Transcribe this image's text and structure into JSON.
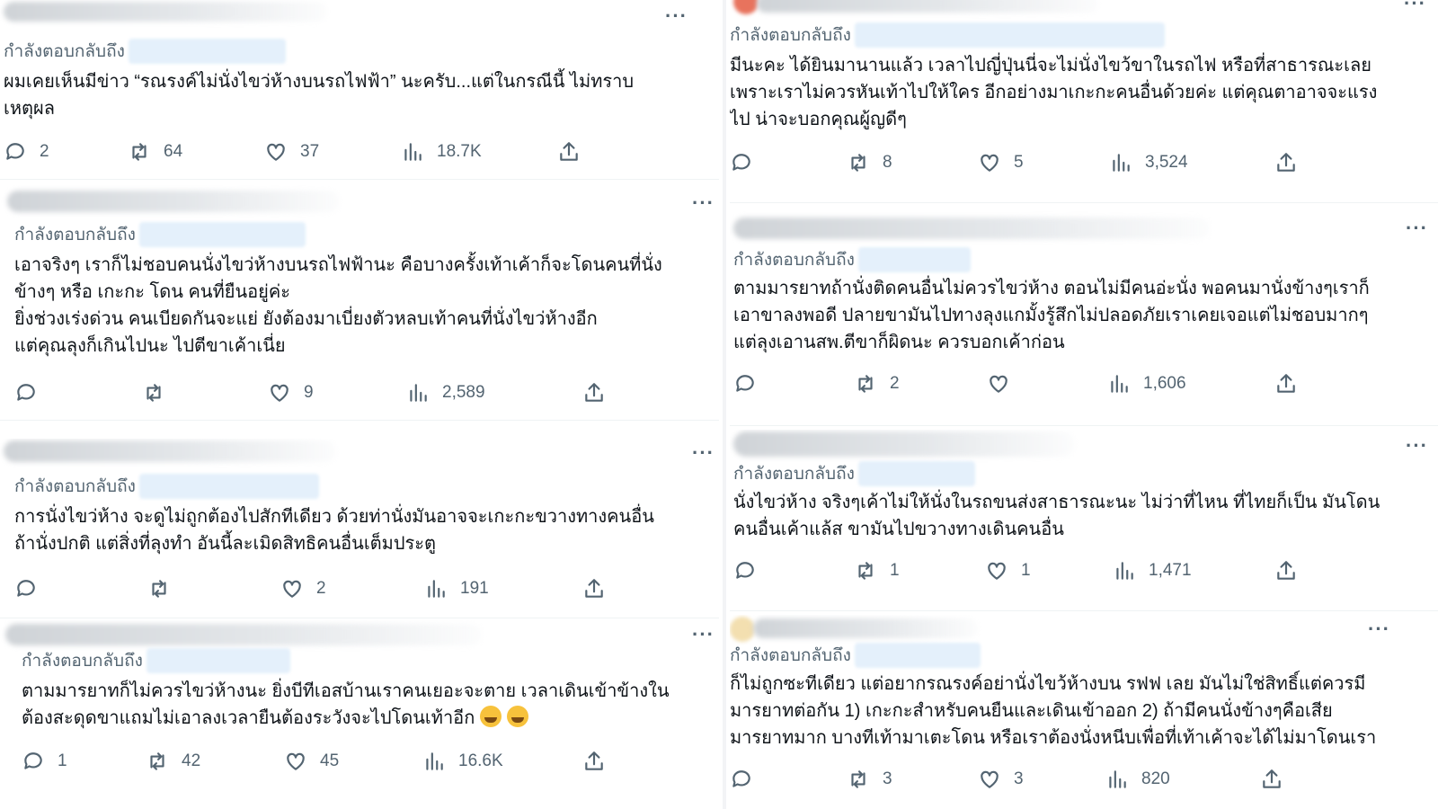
{
  "reply_prefix": "กำลังตอบกลับถึง",
  "more_label": "···",
  "tweets": [
    {
      "text": "ผมเคยเห็นมีข่าว “รณรงค์ไม่นั่งไขว่ห้างบนรถไฟฟ้า” นะครับ...แต่ในกรณีนี้ ไม่ทราบ\nเหตุผล",
      "replies": "2",
      "retweets": "64",
      "likes": "37",
      "views": "18.7K"
    },
    {
      "text": "เอาจริงๆ เราก็ไม่ชอบคนนั่งไขว่ห้างบนรถไฟฟ้านะ คือบางครั้งเท้าเค้าก็จะโดนคนที่นั่ง\nข้างๆ หรือ เกะกะ โดน คนที่ยืนอยู่ค่ะ\nยิ่งช่วงเร่งด่วน คนเบียดกันจะแย่ ยังต้องมาเบี่ยงตัวหลบเท้าคนที่นั่งไขว่ห้างอีก\nแต่คุณลุงก็เกินไปนะ ไปตีขาเค้าเนี่ย",
      "replies": "",
      "retweets": "",
      "likes": "9",
      "views": "2,589"
    },
    {
      "text": "การนั่งไขว่ห้าง จะดูไม่ถูกต้องไปสักทีเดียว ด้วยท่านั่งมันอาจจะเกะกะขวางทางคนอื่น\nถ้านั่งปกติ แต่สิ่งที่ลุงทำ อันนี้ละเมิดสิทธิคนอื่นเต็มประตู",
      "replies": "",
      "retweets": "",
      "likes": "2",
      "views": "191"
    },
    {
      "text": "ตามมารยาทก็ไม่ควรไขว่ห้างนะ ยิ่งบีทีเอสบ้านเราคนเยอะจะตาย เวลาเดินเข้าข้างใน\nต้องสะดุดขาแถมไม่เอาลงเวลายืนต้องระวังจะไปโดนเท้าอีก",
      "replies": "1",
      "retweets": "42",
      "likes": "45",
      "views": "16.6K"
    },
    {
      "text": "มีนะคะ ได้ยินมานานแล้ว เวลาไปญี่ปุ่นนี่จะไม่นั่งไขว้ขาในรถไฟ หรือที่สาธารณะเลย\nเพราะเราไม่ควรหันเท้าไปให้ใคร อีกอย่างมาเกะกะคนอื่นด้วยค่ะ แต่คุณตาอาจจะแรง\nไป น่าจะบอกคุณผู้ญดีๆ",
      "replies": "",
      "retweets": "8",
      "likes": "5",
      "views": "3,524"
    },
    {
      "text": "ตามมารยาทถ้านั่งติดคนอื่นไม่ควรไขว่ห้าง ตอนไม่มีคนอ่ะนั่ง พอคนมานั่งข้างๆเราก็\nเอาขาลงพอดี ปลายขามันไปทางลุงแกมั้งรู้สึกไม่ปลอดภัยเราเคยเจอแต่ไม่ชอบมากๆ\nแต่ลุงเอานสพ.ตีขาก็ผิดนะ ควรบอกเค้าก่อน",
      "replies": "",
      "retweets": "2",
      "likes": "",
      "views": "1,606"
    },
    {
      "text": "นั่งไขว่ห้าง จริงๆเค้าไม่ให้นั่งในรถขนส่งสาธารณะนะ ไม่ว่าที่ไหน ที่ไทยก็เป็น มันโดน\nคนอื่นเค้าแล้ส ขามันไปขวางทางเดินคนอื่น",
      "replies": "",
      "retweets": "1",
      "likes": "1",
      "views": "1,471"
    },
    {
      "text": "ก็ไม่ถูกซะทีเดียว แต่อยากรณรงค์อย่านั่งไขว้ห้างบน รฟฟ เลย มันไม่ใช่สิทธิ์แต่ควรมี\nมารยาทต่อกัน 1) เกะกะสำหรับคนยืนและเดินเข้าออก 2) ถ้ามีคนนั่งข้างๆคือเสีย\nมารยาทมาก บางทีเท้ามาเตะโดน หรือเราต้องนั่งหนีบเพื่อที่เท้าเค้าจะได้ไม่มาโดนเรา",
      "replies": "",
      "retweets": "3",
      "likes": "3",
      "views": "820"
    }
  ]
}
